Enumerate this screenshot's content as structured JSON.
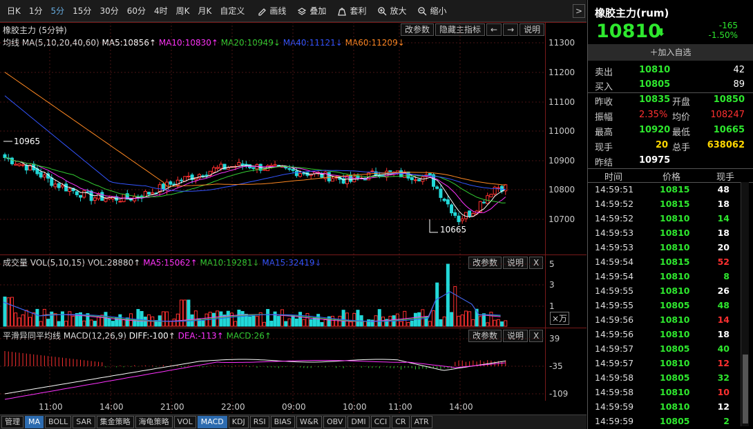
{
  "toolbar": {
    "periods": [
      "日K",
      "1分",
      "5分",
      "15分",
      "30分",
      "60分",
      "4时",
      "周K",
      "月K",
      "自定义"
    ],
    "active_period": "5分",
    "tools": [
      {
        "label": "画线",
        "icon": "pen-icon"
      },
      {
        "label": "叠加",
        "icon": "overlay-icon"
      },
      {
        "label": "套利",
        "icon": "bag-icon"
      },
      {
        "label": "放大",
        "icon": "zoom-in-icon"
      },
      {
        "label": "缩小",
        "icon": "zoom-out-icon"
      }
    ],
    "expand_arrow": ">"
  },
  "main_panel": {
    "title": "橡胶主力 (5分钟)",
    "buttons": [
      "改参数",
      "隐藏主指标",
      "←",
      "→",
      "说明"
    ],
    "ma_label": "均线 MA(5,10,20,40,60)",
    "ma5": "MA5:10856↑",
    "ma10": "MA10:10830↑",
    "ma20": "MA20:10949↓",
    "ma40": "MA40:11121↓",
    "ma60": "MA60:11209↓",
    "high_annotation": "10965",
    "low_annotation": "10665",
    "y_ticks": [
      "11300",
      "11200",
      "11100",
      "11000",
      "10900",
      "10800",
      "10700"
    ]
  },
  "volume_panel": {
    "title": "成交量 VOL(5,10,15)",
    "vol": "VOL:28880↑",
    "ma5": "MA5:15062↑",
    "ma10": "MA10:19281↓",
    "ma15": "MA15:32419↓",
    "buttons": [
      "改参数",
      "说明",
      "X"
    ],
    "y_ticks": [
      "5",
      "3",
      "1"
    ],
    "unit": "×万"
  },
  "macd_panel": {
    "title": "平滑异同平均线 MACD(12,26,9)",
    "diff": "DIFF:-100↑",
    "dea": "DEA:-113↑",
    "macd": "MACD:26↑",
    "buttons": [
      "改参数",
      "说明",
      "X"
    ],
    "y_ticks": [
      "39",
      "-35",
      "-109"
    ]
  },
  "x_axis": [
    "11:00",
    "14:00",
    "21:00",
    "22:00",
    "09:00",
    "10:00",
    "11:00",
    "14:00"
  ],
  "bottom_tabs": [
    "管理",
    "MA",
    "BOLL",
    "SAR",
    "集金策略",
    "海龟策略",
    "VOL",
    "MACD",
    "KDJ",
    "RSI",
    "BIAS",
    "W&R",
    "OBV",
    "DMI",
    "CCI",
    "CR",
    "ATR"
  ],
  "active_tabs": [
    "MA",
    "MACD"
  ],
  "quote": {
    "name": "橡胶主力(rum)",
    "price": "10810",
    "arrow": "⬇",
    "change": "-165",
    "change_pct": "-1.50%",
    "add_watch": "＋加入自选",
    "sell_label": "卖出",
    "sell_price": "10810",
    "sell_vol": "42",
    "buy_label": "买入",
    "buy_price": "10805",
    "buy_vol": "89",
    "prev_close_label": "昨收",
    "prev_close": "10835",
    "open_label": "开盘",
    "open": "10850",
    "amp_label": "振幅",
    "amp": "2.35%",
    "avg_label": "均价",
    "avg": "108247",
    "high_label": "最高",
    "high": "10920",
    "low_label": "最低",
    "low": "10665",
    "cur_vol_label": "现手",
    "cur_vol": "20",
    "total_vol_label": "总手",
    "total_vol": "638062",
    "prev_settle_label": "昨结",
    "prev_settle": "10975"
  },
  "ticks_header": {
    "time": "时间",
    "price": "价格",
    "vol": "现手"
  },
  "ticks": [
    {
      "time": "14:59:51",
      "price": "10815",
      "vol": "48",
      "c": "white"
    },
    {
      "time": "14:59:52",
      "price": "10815",
      "vol": "18",
      "c": "white"
    },
    {
      "time": "14:59:52",
      "price": "10810",
      "vol": "14",
      "c": "green"
    },
    {
      "time": "14:59:53",
      "price": "10810",
      "vol": "18",
      "c": "white"
    },
    {
      "time": "14:59:53",
      "price": "10810",
      "vol": "20",
      "c": "white"
    },
    {
      "time": "14:59:54",
      "price": "10815",
      "vol": "52",
      "c": "red"
    },
    {
      "time": "14:59:54",
      "price": "10810",
      "vol": "8",
      "c": "green"
    },
    {
      "time": "14:59:55",
      "price": "10810",
      "vol": "26",
      "c": "white"
    },
    {
      "time": "14:59:55",
      "price": "10805",
      "vol": "48",
      "c": "green"
    },
    {
      "time": "14:59:56",
      "price": "10810",
      "vol": "14",
      "c": "red"
    },
    {
      "time": "14:59:56",
      "price": "10810",
      "vol": "18",
      "c": "white"
    },
    {
      "time": "14:59:57",
      "price": "10805",
      "vol": "40",
      "c": "green"
    },
    {
      "time": "14:59:57",
      "price": "10810",
      "vol": "12",
      "c": "red"
    },
    {
      "time": "14:59:58",
      "price": "10805",
      "vol": "32",
      "c": "green"
    },
    {
      "time": "14:59:58",
      "price": "10810",
      "vol": "10",
      "c": "red"
    },
    {
      "time": "14:59:59",
      "price": "10810",
      "vol": "12",
      "c": "white"
    },
    {
      "time": "14:59:59",
      "price": "10805",
      "vol": "2",
      "c": "green"
    }
  ],
  "colors": {
    "up": "#ff3030",
    "down": "#2ee82e",
    "ma5": "#ffffff",
    "ma10": "#ff33ff",
    "ma20": "#33cc33",
    "ma40": "#3355ff",
    "ma60": "#ff8822",
    "dea": "#ff33ff"
  }
}
